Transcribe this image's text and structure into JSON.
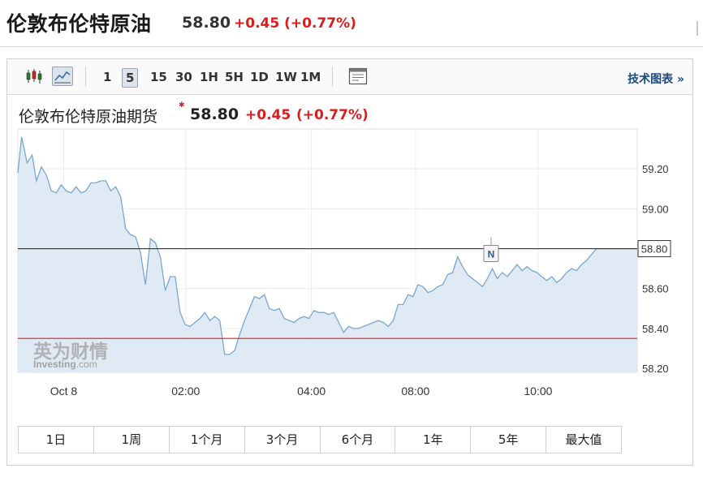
{
  "header": {
    "title": "伦敦布伦特原油",
    "price": "58.80",
    "change": "+0.45 (+0.77%)"
  },
  "toolbar": {
    "icons": [
      "candlestick-chart-icon",
      "line-chart-icon",
      "indicator-panel-icon"
    ],
    "timeframes": [
      "1",
      "5",
      "15",
      "30",
      "1H",
      "5H",
      "1D",
      "1W",
      "1M"
    ],
    "active_timeframe": "5",
    "tech_link": "技术图表 »"
  },
  "chart_header": {
    "title": "伦敦布伦特原油期货",
    "price": "58.80",
    "change": "+0.45",
    "change_pct": "(+0.77%)"
  },
  "watermark": {
    "cn": "英为财情",
    "en": "Investing",
    "domain": ".com"
  },
  "colors": {
    "line": "#7aa7d0",
    "area": "#dce8f3",
    "up": "#dd1c1c",
    "reference_line": "#dd1c1c",
    "current_price_line": "#333333"
  },
  "chart_data": {
    "type": "area",
    "x_ticks": [
      "Oct 8",
      "02:00",
      "04:00",
      "08:00",
      "10:00"
    ],
    "y_ticks": [
      58.2,
      58.4,
      58.6,
      59.0,
      59.2
    ],
    "ylim": [
      58.18,
      59.4
    ],
    "x_range": [
      0,
      100
    ],
    "x_tick_positions": [
      7.4,
      27.1,
      47.4,
      64.2,
      84.0
    ],
    "current_price": 58.8,
    "current_label": "58.80",
    "reference_level": 58.35,
    "marker": {
      "label": "N",
      "x": 76.4
    },
    "series": [
      {
        "x": [
          0.0,
          0.6,
          1.5,
          2.3,
          3.0,
          3.8,
          4.6,
          5.4,
          6.2,
          7.0,
          7.8,
          8.6,
          9.4,
          10.2,
          11.0,
          11.8,
          12.6,
          13.4,
          14.2,
          15.0,
          15.8,
          16.6,
          17.4,
          18.2,
          19.0,
          19.8,
          20.6,
          21.4,
          22.2,
          23.0,
          23.8,
          24.6,
          25.4,
          26.2,
          27.0,
          27.8,
          28.6,
          29.4,
          30.2,
          31.0,
          31.8,
          32.6,
          33.4,
          34.2,
          35.0,
          35.8,
          36.6,
          37.4,
          38.2,
          39.0,
          39.8,
          40.6,
          41.4,
          42.2,
          43.0,
          43.8,
          44.6,
          45.4,
          46.2,
          47.0,
          47.8,
          48.6,
          49.4,
          50.2,
          51.0,
          51.8,
          52.6,
          53.4,
          54.2,
          55.0,
          55.8,
          56.6,
          57.4,
          58.2,
          59.0,
          59.8,
          60.6,
          61.4,
          62.2,
          63.0,
          63.8,
          64.6,
          65.4,
          66.2,
          67.0,
          67.8,
          68.6,
          69.4,
          70.2,
          71.0,
          71.8,
          72.6,
          73.4,
          74.2,
          75.0,
          75.8,
          76.6,
          77.4,
          78.2,
          79.0,
          79.8,
          80.6,
          81.4,
          82.2,
          83.0,
          83.8,
          84.6,
          85.4,
          86.2,
          87.0,
          87.8,
          88.6,
          89.4,
          90.2,
          91.0,
          91.8,
          92.6,
          93.4,
          94.2,
          95.0,
          95.8,
          96.6,
          97.4,
          98.2,
          99.0,
          100.0
        ],
        "y": [
          59.18,
          59.36,
          59.23,
          59.27,
          59.14,
          59.21,
          59.17,
          59.09,
          59.08,
          59.12,
          59.09,
          59.08,
          59.11,
          59.08,
          59.09,
          59.13,
          59.13,
          59.14,
          59.14,
          59.09,
          59.11,
          59.06,
          58.9,
          58.87,
          58.86,
          58.78,
          58.62,
          58.85,
          58.83,
          58.76,
          58.59,
          58.66,
          58.66,
          58.48,
          58.42,
          58.41,
          58.43,
          58.45,
          58.48,
          58.44,
          58.46,
          58.44,
          58.27,
          58.27,
          58.29,
          58.37,
          58.44,
          58.5,
          58.56,
          58.55,
          58.57,
          58.5,
          58.49,
          58.5,
          58.45,
          58.44,
          58.43,
          58.45,
          58.46,
          58.45,
          58.49,
          58.48,
          58.48,
          58.47,
          58.48,
          58.43,
          58.38,
          58.41,
          58.4,
          58.4,
          58.41,
          58.42,
          58.43,
          58.44,
          58.43,
          58.41,
          58.44,
          58.52,
          58.52,
          58.57,
          58.56,
          58.62,
          58.61,
          58.58,
          58.59,
          58.61,
          58.62,
          58.67,
          58.68,
          58.76,
          58.71,
          58.67,
          58.65,
          58.63,
          58.61,
          58.65,
          58.7,
          58.65,
          58.68,
          58.66,
          58.69,
          58.72,
          58.69,
          58.71,
          58.69,
          58.68,
          58.66,
          58.64,
          58.66,
          58.63,
          58.65,
          58.68,
          58.7,
          58.69,
          58.72,
          58.74,
          58.77,
          58.8,
          58.8,
          58.8,
          58.8,
          58.8,
          58.8,
          58.8,
          58.8,
          58.8
        ]
      }
    ]
  },
  "ranges": [
    "1日",
    "1周",
    "1个月",
    "3个月",
    "6个月",
    "1年",
    "5年",
    "最大值"
  ]
}
